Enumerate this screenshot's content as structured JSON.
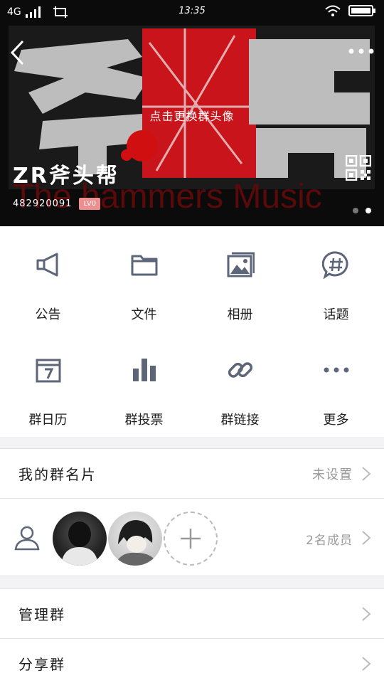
{
  "status_bar": {
    "network": "4G",
    "time": "13:35"
  },
  "header": {
    "change_avatar_label": "点击更换群头像",
    "group_name": "ZR斧头帮",
    "group_id": "482920091",
    "level_badge": "LV0",
    "banner_text": "The hammers Music"
  },
  "features": [
    {
      "label": "公告",
      "icon": "megaphone-icon"
    },
    {
      "label": "文件",
      "icon": "folder-icon"
    },
    {
      "label": "相册",
      "icon": "album-icon"
    },
    {
      "label": "话题",
      "icon": "hashtag-bubble-icon"
    },
    {
      "label": "群日历",
      "icon": "calendar-icon"
    },
    {
      "label": "群投票",
      "icon": "bar-chart-icon"
    },
    {
      "label": "群链接",
      "icon": "link-icon"
    },
    {
      "label": "更多",
      "icon": "more-icon"
    }
  ],
  "my_card": {
    "title": "我的群名片",
    "value": "未设置"
  },
  "members": {
    "count_label": "2名成员"
  },
  "manage": {
    "title": "管理群"
  },
  "share": {
    "title": "分享群"
  },
  "colors": {
    "accent_red": "#d11212",
    "icon_gray": "#5d6578",
    "badge": "#ee8f8f"
  }
}
